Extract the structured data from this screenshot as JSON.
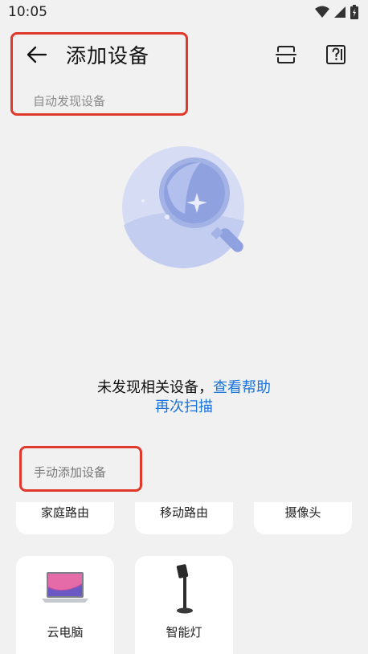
{
  "status": {
    "time": "10:05"
  },
  "header": {
    "title": "添加设备"
  },
  "auto_discover": {
    "label": "自动发现设备",
    "empty_message": "未发现相关设备，",
    "help_link": "查看帮助",
    "rescan_link": "再次扫描"
  },
  "manual": {
    "label": "手动添加设备",
    "devices": [
      {
        "label": "家庭路由",
        "icon": "router-icon"
      },
      {
        "label": "移动路由",
        "icon": "mobile-router-icon"
      },
      {
        "label": "摄像头",
        "icon": "camera-icon"
      },
      {
        "label": "云电脑",
        "icon": "laptop-icon"
      },
      {
        "label": "智能灯",
        "icon": "lamp-icon"
      }
    ]
  },
  "colors": {
    "accent": "#1a73d9",
    "highlight": "#e0392b",
    "background": "#f1f1f1",
    "illustration": "#9aa9e0"
  }
}
